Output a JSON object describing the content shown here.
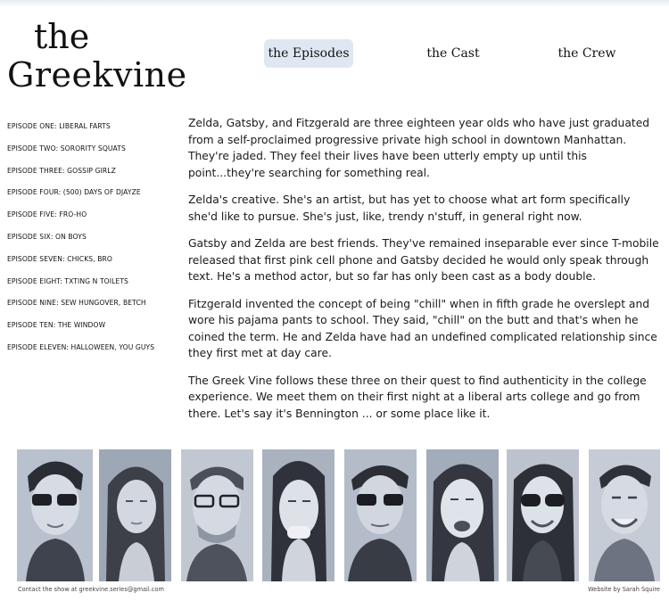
{
  "logo": {
    "line1": "the",
    "line2": "Greekvine"
  },
  "nav": [
    {
      "label": "the Episodes"
    },
    {
      "label": "the Cast"
    },
    {
      "label": "the Crew"
    }
  ],
  "episodes": [
    "Episode One: Liberal Farts",
    "Episode Two: Sorority Squats",
    "Episode Three: Gossip Girlz",
    "Episode Four: (500) Days of Djayze",
    "Episode Five: Fro-Ho",
    "Episode Six: On Boys",
    "Episode Seven: Chicks, Bro",
    "Episode Eight: Txting N Toilets",
    "Episode Nine: Sew Hungover, Betch",
    "Episode Ten: The Window",
    "Episode Eleven: Halloween, You Guys"
  ],
  "paragraphs": [
    "Zelda, Gatsby, and Fitzgerald are three eighteen year olds who have just graduated from a self-proclaimed progressive private high school in downtown Manhattan. They're jaded. They feel their lives have been utterly empty up until this point...they're searching for something real.",
    "Zelda's creative. She's an artist, but has yet to choose what art form specifically she'd like to pursue. She's just, like, trendy n'stuff, in general right now.",
    "Gatsby and Zelda are best friends. They've remained inseparable ever since T-mobile released that first pink cell phone and Gatsby decided he would only speak through text. He's a method actor, but so far has only been cast as a body double.",
    "Fitzgerald invented the concept of being \"chill\" when in fifth grade he overslept and wore his pajama pants to school. They said, \"chill\" on the butt and that's when he coined the term. He and Zelda have had an undefined complicated relationship since they first met at day care.",
    "The Greek Vine follows these three on their quest to find authenticity in the college experience. We meet them on their first night at a liberal arts college and go from there. Let's say it's Bennington ... or some place like it."
  ],
  "footer": {
    "contact": "Contact the show at greekvine.series@gmail.com",
    "credit": "Website by Sarah Squire"
  },
  "colors": {
    "nav_active_bg": "#dfe8f2",
    "photo_tint": "#9aa3b2"
  }
}
